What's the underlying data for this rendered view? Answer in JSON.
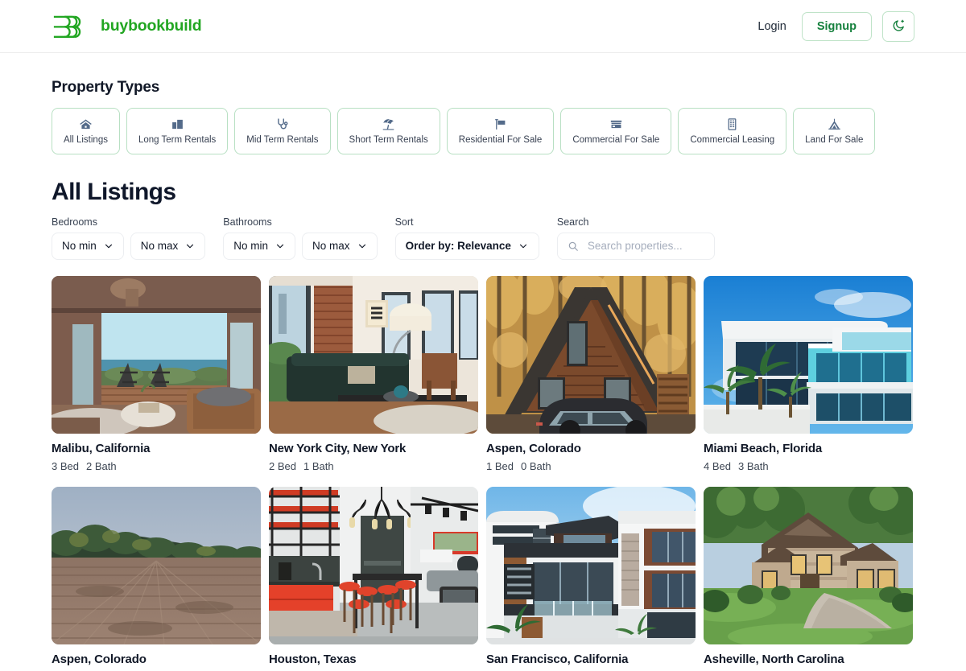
{
  "header": {
    "brand_name": "buybookbuild",
    "brand_icon": "bbb-logo-icon",
    "brand_color": "#22a622",
    "login_label": "Login",
    "signup_label": "Signup",
    "theme_toggle_icon": "crescent-moon-icon"
  },
  "property_types": {
    "heading": "Property Types",
    "items": [
      {
        "label": "All Listings",
        "icon": "house-icon"
      },
      {
        "label": "Long Term Rentals",
        "icon": "apartment-building-icon"
      },
      {
        "label": "Mid Term Rentals",
        "icon": "stethoscope-icon"
      },
      {
        "label": "Short Term Rentals",
        "icon": "beach-umbrella-icon"
      },
      {
        "label": "Residential For Sale",
        "icon": "for-sale-sign-icon"
      },
      {
        "label": "Commercial For Sale",
        "icon": "storefront-icon"
      },
      {
        "label": "Commercial Leasing",
        "icon": "office-building-icon"
      },
      {
        "label": "Land For Sale",
        "icon": "tent-icon"
      }
    ]
  },
  "listings": {
    "heading": "All Listings",
    "filters": {
      "bedrooms_label": "Bedrooms",
      "bedrooms_min": "No min",
      "bedrooms_max": "No max",
      "bathrooms_label": "Bathrooms",
      "bathrooms_min": "No min",
      "bathrooms_max": "No max",
      "sort_label": "Sort",
      "sort_value": "Order by: Relevance",
      "search_label": "Search",
      "search_value": "",
      "search_placeholder": "Search properties..."
    },
    "cards": [
      {
        "title": "Malibu, California",
        "beds": "3 Bed",
        "baths": "2 Bath",
        "image": "ocean-view-living-room"
      },
      {
        "title": "New York City, New York",
        "beds": "2 Bed",
        "baths": "1 Bath",
        "image": "loft-brick-living-room"
      },
      {
        "title": "Aspen, Colorado",
        "beds": "1 Bed",
        "baths": "0 Bath",
        "image": "a-frame-cabin-autumn"
      },
      {
        "title": "Miami Beach, Florida",
        "beds": "4 Bed",
        "baths": "3 Bath",
        "image": "modern-white-beach-house"
      },
      {
        "title": "Aspen, Colorado",
        "beds": "",
        "baths": "",
        "image": "open-farm-field-treeline"
      },
      {
        "title": "Houston, Texas",
        "beds": "",
        "baths": "",
        "image": "red-industrial-kitchen"
      },
      {
        "title": "San Francisco, California",
        "beds": "",
        "baths": "",
        "image": "modern-hillside-homes"
      },
      {
        "title": "Asheville, North Carolina",
        "beds": "",
        "baths": "",
        "image": "stone-craftsman-house-lawn"
      }
    ]
  }
}
